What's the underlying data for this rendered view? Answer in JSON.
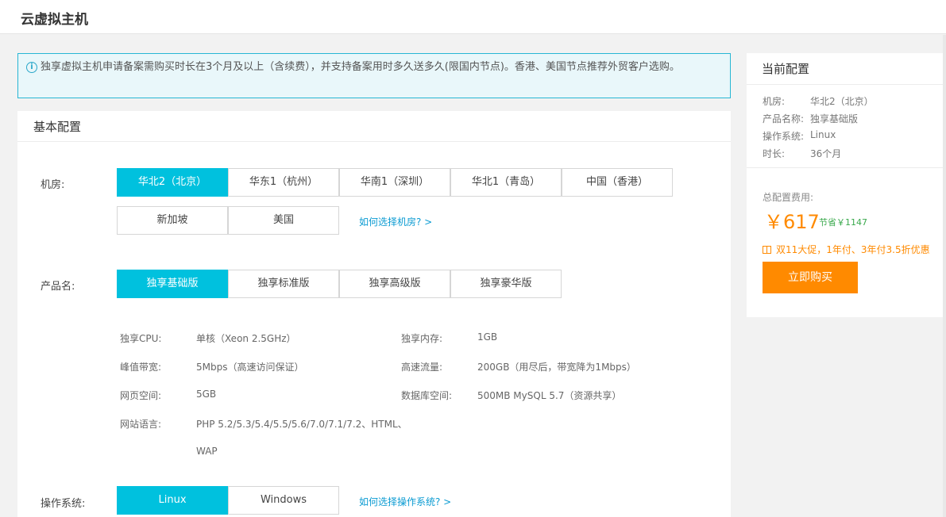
{
  "header": {
    "title": "云虚拟主机"
  },
  "notice": {
    "icon": "info-icon",
    "text": "独享虚拟主机申请备案需购买时长在3个月及以上（含续费），并支持备案用时多久送多久(限国内节点)。香港、美国节点推荐外贸客户选购。"
  },
  "basic": {
    "title": "基本配置",
    "region": {
      "label": "机房:",
      "options": [
        "华北2（北京）",
        "华东1（杭州）",
        "华南1（深圳）",
        "华北1（青岛）",
        "中国（香港）",
        "新加坡",
        "美国"
      ],
      "selected": "华北2（北京）",
      "help": "如何选择机房? >"
    },
    "product": {
      "label": "产品名:",
      "options": [
        "独享基础版",
        "独享标准版",
        "独享高级版",
        "独享豪华版"
      ],
      "selected": "独享基础版"
    },
    "specs": [
      {
        "key": "独享CPU:",
        "value": "单核（Xeon 2.5GHz）"
      },
      {
        "key": "独享内存:",
        "value": "1GB"
      },
      {
        "key": "峰值带宽:",
        "value": "5Mbps（高速访问保证）"
      },
      {
        "key": "高速流量:",
        "value": "200GB（用尽后，带宽降为1Mbps）"
      },
      {
        "key": "网页空间:",
        "value": "5GB"
      },
      {
        "key": "数据库空间:",
        "value": "500MB MySQL 5.7（资源共享）"
      },
      {
        "key": "网站语言:",
        "value": "PHP 5.2/5.3/5.4/5.5/5.6/7.0/7.1/7.2、HTML、",
        "value2": "WAP"
      }
    ],
    "os": {
      "label": "操作系统:",
      "options": [
        "Linux",
        "Windows"
      ],
      "selected": "Linux",
      "help": "如何选择操作系统? >"
    }
  },
  "summary": {
    "title": "当前配置",
    "items": [
      {
        "key": "机房:",
        "value": "华北2（北京）"
      },
      {
        "key": "产品名称:",
        "value": "独享基础版"
      },
      {
        "key": "操作系统:",
        "value": "Linux"
      },
      {
        "key": "时长:",
        "value": "36个月"
      }
    ],
    "total_label": "总配置费用:",
    "price": "￥617",
    "save": "节省￥1147",
    "promo": "双11大促，1年付、3年付3.5折优惠",
    "buy_label": "立即购买"
  },
  "colors": {
    "accent": "#00c1de",
    "price": "#ff8a00",
    "buy_button": "#ff8a00",
    "save": "#3aa94d",
    "link": "#0b9bd2"
  }
}
